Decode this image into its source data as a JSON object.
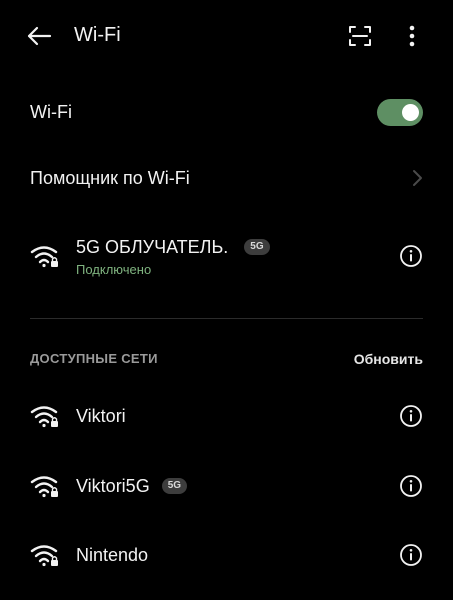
{
  "app_bar": {
    "title": "Wi-Fi",
    "back_icon": "arrow-left-icon",
    "scan_icon": "qr-scan-icon",
    "more_icon": "more-vert-icon"
  },
  "wifi_toggle": {
    "label": "Wi-Fi",
    "enabled": true,
    "on_color": "#5e8f63"
  },
  "assistant": {
    "label": "Помощник по Wi-Fi"
  },
  "connected_network": {
    "name": "5G ОБЛУЧАТЕЛЬ.",
    "badge": "5G",
    "status": "Подключено",
    "status_color": "#7fb37f"
  },
  "available": {
    "header": "ДОСТУПНЫЕ СЕТИ",
    "refresh_label": "Обновить",
    "networks": [
      {
        "name": "Viktori",
        "badge": ""
      },
      {
        "name": "Viktori5G",
        "badge": "5G"
      },
      {
        "name": "Nintendo",
        "badge": ""
      }
    ]
  }
}
